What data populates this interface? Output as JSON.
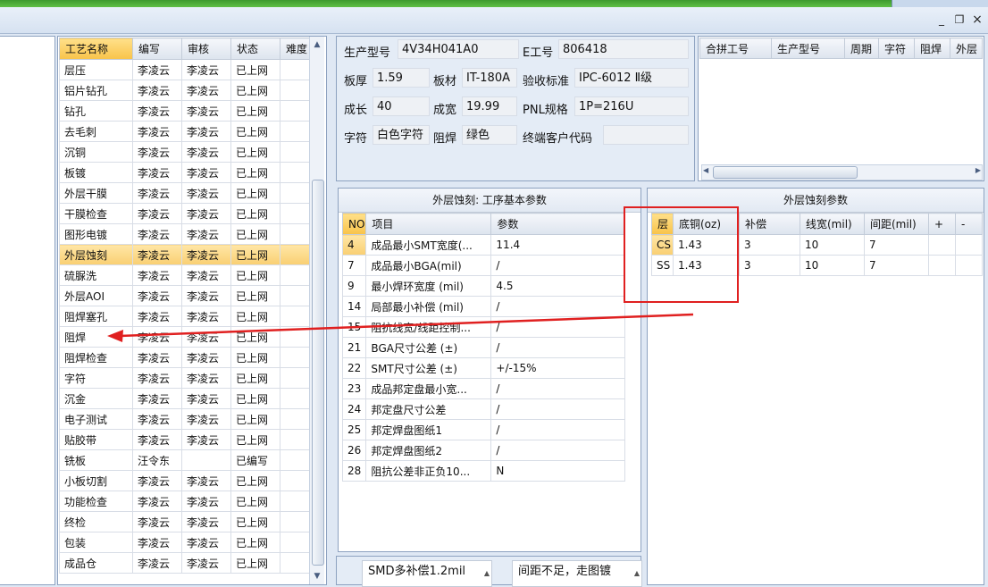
{
  "window": {
    "min_icon": "minimize-icon",
    "restore_icon": "restore-icon",
    "close_icon": "close-icon",
    "min": "_",
    "restore": "❐",
    "close": "×"
  },
  "process_list": {
    "headers": [
      "工艺名称",
      "编写",
      "审核",
      "状态",
      "难度"
    ],
    "rows": [
      [
        "层压",
        "李凌云",
        "李凌云",
        "已上网",
        ""
      ],
      [
        "铝片钻孔",
        "李凌云",
        "李凌云",
        "已上网",
        ""
      ],
      [
        "钻孔",
        "李凌云",
        "李凌云",
        "已上网",
        ""
      ],
      [
        "去毛刺",
        "李凌云",
        "李凌云",
        "已上网",
        ""
      ],
      [
        "沉铜",
        "李凌云",
        "李凌云",
        "已上网",
        ""
      ],
      [
        "板镀",
        "李凌云",
        "李凌云",
        "已上网",
        ""
      ],
      [
        "外层干膜",
        "李凌云",
        "李凌云",
        "已上网",
        ""
      ],
      [
        "干膜检查",
        "李凌云",
        "李凌云",
        "已上网",
        ""
      ],
      [
        "图形电镀",
        "李凌云",
        "李凌云",
        "已上网",
        ""
      ],
      [
        "外层蚀刻",
        "李凌云",
        "李凌云",
        "已上网",
        ""
      ],
      [
        "硫脲洗",
        "李凌云",
        "李凌云",
        "已上网",
        ""
      ],
      [
        "外层AOI",
        "李凌云",
        "李凌云",
        "已上网",
        ""
      ],
      [
        "阻焊塞孔",
        "李凌云",
        "李凌云",
        "已上网",
        ""
      ],
      [
        "阻焊",
        "李凌云",
        "李凌云",
        "已上网",
        ""
      ],
      [
        "阻焊检查",
        "李凌云",
        "李凌云",
        "已上网",
        ""
      ],
      [
        "字符",
        "李凌云",
        "李凌云",
        "已上网",
        ""
      ],
      [
        "沉金",
        "李凌云",
        "李凌云",
        "已上网",
        ""
      ],
      [
        "电子测试",
        "李凌云",
        "李凌云",
        "已上网",
        ""
      ],
      [
        "贴胶带",
        "李凌云",
        "李凌云",
        "已上网",
        ""
      ],
      [
        "铣板",
        "汪令东",
        "",
        "已编写",
        ""
      ],
      [
        "小板切割",
        "李凌云",
        "李凌云",
        "已上网",
        ""
      ],
      [
        "功能检查",
        "李凌云",
        "李凌云",
        "已上网",
        ""
      ],
      [
        "终检",
        "李凌云",
        "李凌云",
        "已上网",
        ""
      ],
      [
        "包装",
        "李凌云",
        "李凌云",
        "已上网",
        ""
      ],
      [
        "成品仓",
        "李凌云",
        "李凌云",
        "已上网",
        ""
      ]
    ],
    "selected_index": 9
  },
  "info": {
    "model_label": "生产型号",
    "model": "4V34H041A0",
    "eno_label": "E工号",
    "eno": "806418",
    "thickness_label": "板厚",
    "thickness": "1.59",
    "material_label": "板材",
    "material": "IT-180A",
    "standard_label": "验收标准",
    "standard": "IPC-6012 Ⅱ级",
    "length_label": "成长",
    "length": "40",
    "width_label": "成宽",
    "width": "19.99",
    "pnl_label": "PNL规格",
    "pnl": "1P=216U",
    "char_label": "字符",
    "char": "白色字符",
    "mask_label": "阻焊",
    "mask": "绿色",
    "customer_label": "终端客户代码",
    "customer": ""
  },
  "top_grid": {
    "headers": [
      "合拼工号",
      "生产型号",
      "周期",
      "字符",
      "阻焊",
      "外层"
    ]
  },
  "basic_params": {
    "title": "外层蚀刻: 工序基本参数",
    "headers": [
      "NO",
      "项目",
      "参数"
    ],
    "rows": [
      [
        "4",
        "成品最小SMT宽度(...",
        "11.4"
      ],
      [
        "7",
        "成品最小BGA(mil)",
        "/"
      ],
      [
        "9",
        "最小焊环宽度 (mil)",
        "4.5"
      ],
      [
        "14",
        "局部最小补偿 (mil)",
        "/"
      ],
      [
        "15",
        "阻抗线宽/线距控制...",
        "/"
      ],
      [
        "21",
        "BGA尺寸公差 (±)",
        "/"
      ],
      [
        "22",
        "SMT尺寸公差 (±)",
        "+/-15%"
      ],
      [
        "23",
        "成品邦定盘最小宽...",
        "/"
      ],
      [
        "24",
        "邦定盘尺寸公差",
        "/"
      ],
      [
        "25",
        "邦定焊盘图纸1",
        "/"
      ],
      [
        "26",
        "邦定焊盘图纸2",
        "/"
      ],
      [
        "28",
        "阻抗公差非正负10...",
        "N"
      ]
    ]
  },
  "etch_params": {
    "title": "外层蚀刻参数",
    "headers": [
      "层",
      "底铜(oz)",
      "补偿",
      "线宽(mil)",
      "间距(mil)",
      "+",
      "-"
    ],
    "rows": [
      [
        "CS",
        "1.43",
        "3",
        "10",
        "7"
      ],
      [
        "SS",
        "1.43",
        "3",
        "10",
        "7"
      ]
    ]
  },
  "notes": {
    "note1": "SMD多补偿1.2mil",
    "note2": "间距不足，走图镀"
  },
  "annotation_color": "#e02020"
}
